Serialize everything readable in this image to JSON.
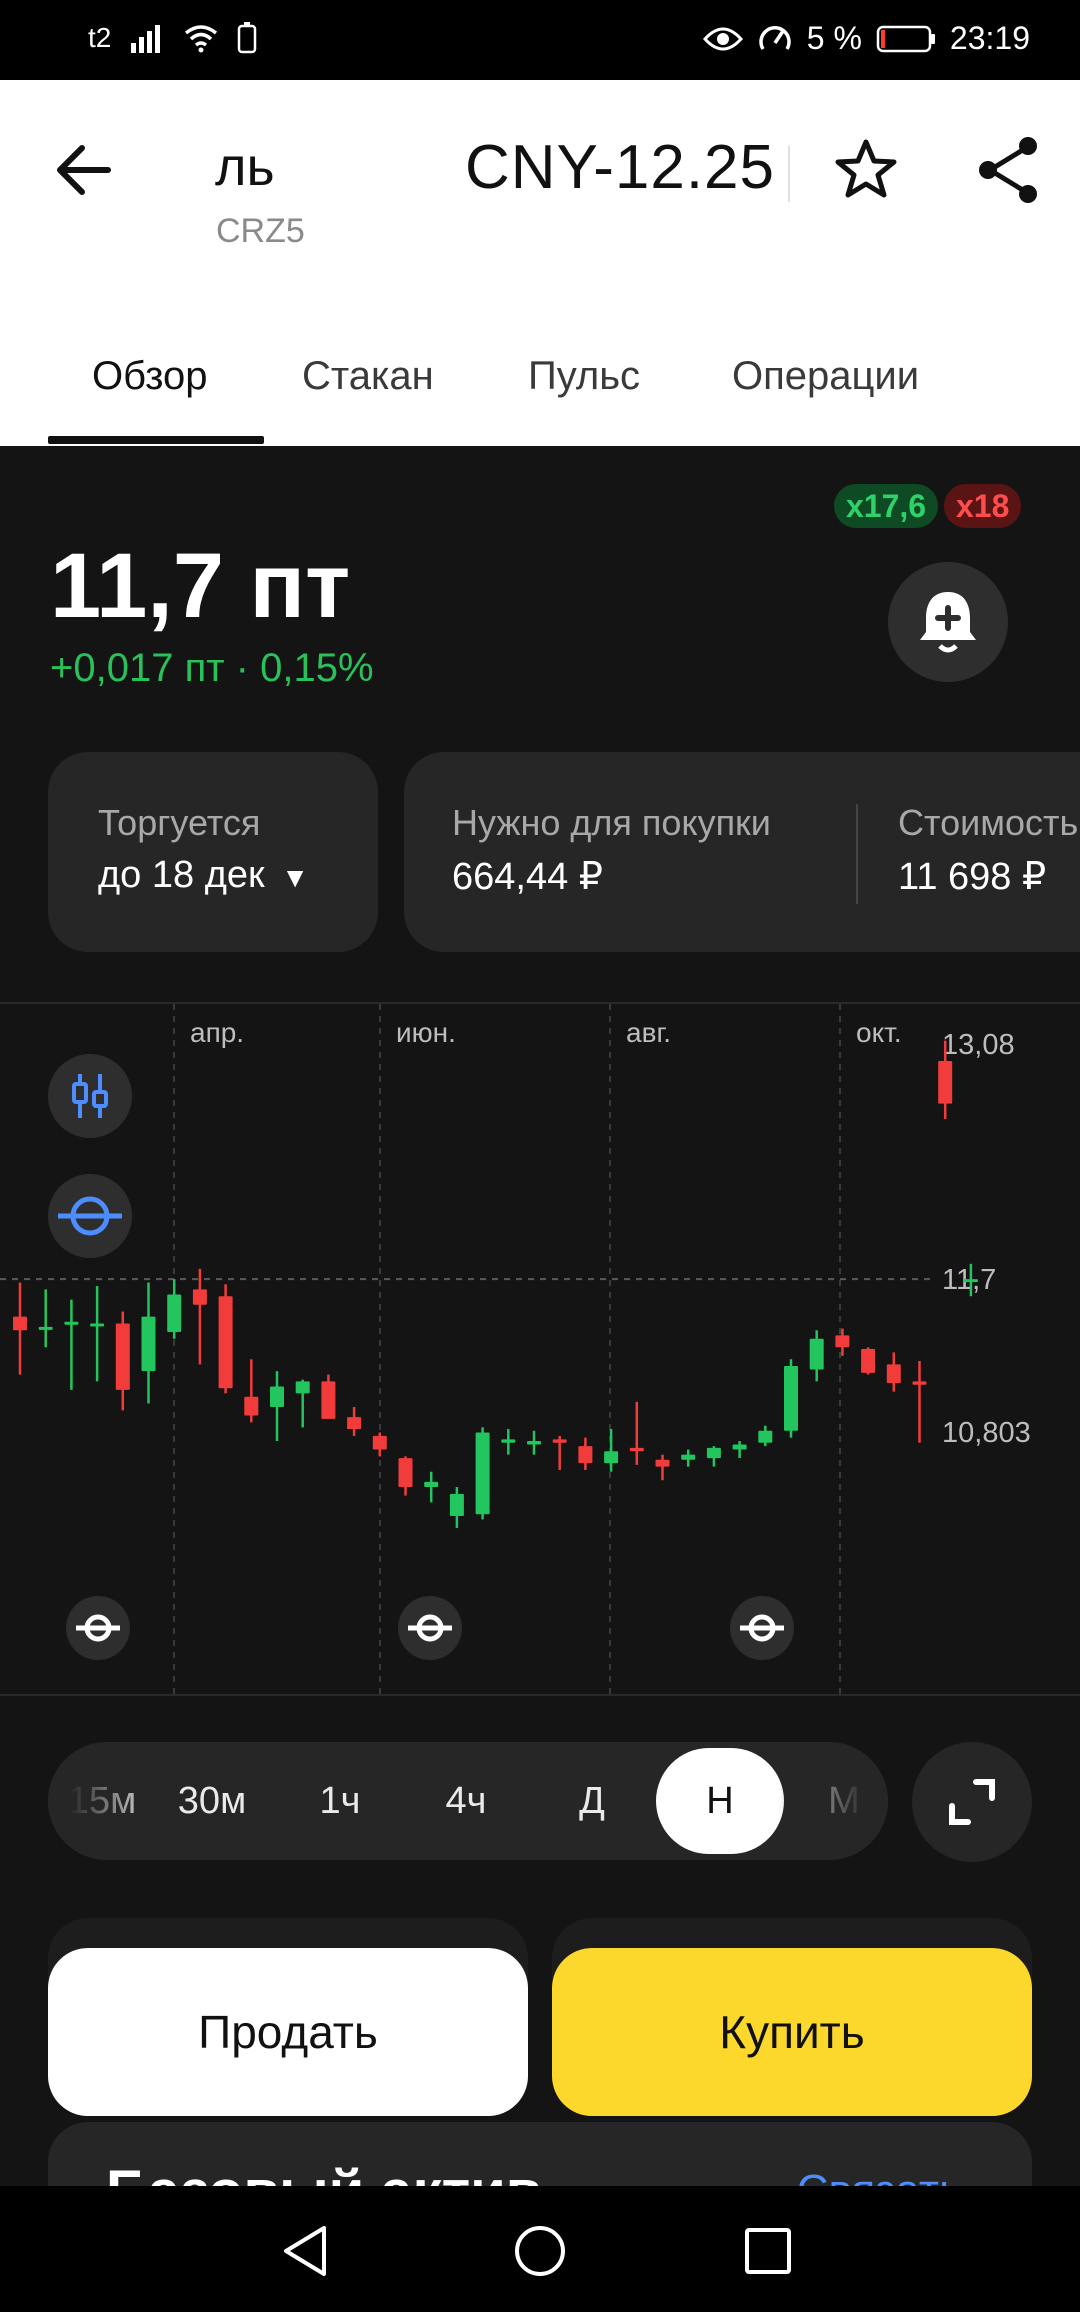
{
  "status_bar": {
    "carrier": "t2",
    "battery": "5 %",
    "time": "23:19"
  },
  "header": {
    "title_fragment": "ль",
    "ticker": "CRZ5",
    "title": "CNY-12.25",
    "back_icon": "arrow-left-icon",
    "favorite_icon": "star-icon",
    "share_icon": "share-icon"
  },
  "tabs": [
    {
      "label": "Обзор",
      "active": true
    },
    {
      "label": "Стакан",
      "active": false
    },
    {
      "label": "Пульс",
      "active": false
    },
    {
      "label": "Операции",
      "active": false
    }
  ],
  "quote": {
    "price": "11,7 пт",
    "change": "+0,017 пт · 0,15%",
    "leverage_long": "x17,6",
    "leverage_short": "x18",
    "alert_icon": "bell-plus-icon"
  },
  "cards": {
    "trade_label": "Торгуется",
    "trade_value": "до 18 дек",
    "margin_label": "Нужно для покупки",
    "margin_value": "664,44 ₽",
    "cost_label": "Стоимость",
    "cost_value": "11 698 ₽"
  },
  "chart_data": {
    "type": "candlestick",
    "x_tick_labels": [
      "апр.",
      "июн.",
      "авг.",
      "окт."
    ],
    "y_tick_labels": [
      "13,08",
      "11,7",
      "10,803"
    ],
    "ylim": [
      10.62,
      13.32
    ],
    "current_value": 11.7,
    "colors": {
      "up": "#22c55e",
      "down": "#f23c3c"
    },
    "candles": [
      {
        "o": 11.48,
        "h": 11.68,
        "l": 11.14,
        "c": 11.4
      },
      {
        "o": 11.41,
        "h": 11.64,
        "l": 11.3,
        "c": 11.42
      },
      {
        "o": 11.44,
        "h": 11.58,
        "l": 11.05,
        "c": 11.45
      },
      {
        "o": 11.43,
        "h": 11.66,
        "l": 11.1,
        "c": 11.44
      },
      {
        "o": 11.44,
        "h": 11.51,
        "l": 10.93,
        "c": 11.05
      },
      {
        "o": 11.16,
        "h": 11.68,
        "l": 10.97,
        "c": 11.48
      },
      {
        "o": 11.39,
        "h": 11.7,
        "l": 11.35,
        "c": 11.61
      },
      {
        "o": 11.64,
        "h": 11.76,
        "l": 11.2,
        "c": 11.55
      },
      {
        "o": 11.6,
        "h": 11.67,
        "l": 11.03,
        "c": 11.06
      },
      {
        "o": 11.01,
        "h": 11.23,
        "l": 10.86,
        "c": 10.9
      },
      {
        "o": 10.95,
        "h": 11.16,
        "l": 10.75,
        "c": 11.07
      },
      {
        "o": 11.03,
        "h": 11.11,
        "l": 10.83,
        "c": 11.1
      },
      {
        "o": 11.1,
        "h": 11.14,
        "l": 10.9,
        "c": 10.88
      },
      {
        "o": 10.89,
        "h": 10.95,
        "l": 10.78,
        "c": 10.82
      },
      {
        "o": 10.78,
        "h": 10.8,
        "l": 10.66,
        "c": 10.7
      },
      {
        "o": 10.65,
        "h": 10.66,
        "l": 10.43,
        "c": 10.48
      },
      {
        "o": 10.48,
        "h": 10.57,
        "l": 10.39,
        "c": 10.51
      },
      {
        "o": 10.31,
        "h": 10.48,
        "l": 10.24,
        "c": 10.44
      },
      {
        "o": 10.32,
        "h": 10.83,
        "l": 10.29,
        "c": 10.8
      },
      {
        "o": 10.74,
        "h": 10.82,
        "l": 10.67,
        "c": 10.76
      },
      {
        "o": 10.73,
        "h": 10.81,
        "l": 10.67,
        "c": 10.75
      },
      {
        "o": 10.76,
        "h": 10.78,
        "l": 10.58,
        "c": 10.74
      },
      {
        "o": 10.72,
        "h": 10.77,
        "l": 10.58,
        "c": 10.62
      },
      {
        "o": 10.62,
        "h": 10.82,
        "l": 10.57,
        "c": 10.69
      },
      {
        "o": 10.71,
        "h": 10.98,
        "l": 10.61,
        "c": 10.69
      },
      {
        "o": 10.64,
        "h": 10.67,
        "l": 10.52,
        "c": 10.6
      },
      {
        "o": 10.64,
        "h": 10.7,
        "l": 10.6,
        "c": 10.67
      },
      {
        "o": 10.65,
        "h": 10.72,
        "l": 10.6,
        "c": 10.71
      },
      {
        "o": 10.7,
        "h": 10.75,
        "l": 10.65,
        "c": 10.73
      },
      {
        "o": 10.74,
        "h": 10.84,
        "l": 10.72,
        "c": 10.81
      },
      {
        "o": 10.81,
        "h": 11.23,
        "l": 10.77,
        "c": 11.19
      },
      {
        "o": 11.17,
        "h": 11.4,
        "l": 11.1,
        "c": 11.35
      },
      {
        "o": 11.37,
        "h": 11.41,
        "l": 11.25,
        "c": 11.3
      },
      {
        "o": 11.29,
        "h": 11.3,
        "l": 11.14,
        "c": 11.15
      },
      {
        "o": 11.2,
        "h": 11.27,
        "l": 11.04,
        "c": 11.09
      },
      {
        "o": 11.1,
        "h": 11.22,
        "l": 10.74,
        "c": 11.08
      },
      {
        "o": 12.98,
        "h": 13.1,
        "l": 12.64,
        "c": 12.73
      },
      {
        "o": 11.7,
        "h": 11.79,
        "l": 11.6,
        "c": 11.7
      }
    ]
  },
  "chart_tools": {
    "indicators_icon": "candlestick-settings-icon",
    "crosshair_icon": "crosshair-icon"
  },
  "intervals": [
    "15м",
    "30м",
    "1ч",
    "4ч",
    "Д",
    "Н",
    "М"
  ],
  "active_interval": "Н",
  "expand_icon": "expand-icon",
  "actions": {
    "sell": "Продать",
    "buy": "Купить"
  },
  "base_asset": {
    "title": "Базовый актив",
    "link": "Связать"
  },
  "nav": {
    "back_icon": "nav-back-icon",
    "home_icon": "nav-home-icon",
    "recents_icon": "nav-recents-icon"
  }
}
